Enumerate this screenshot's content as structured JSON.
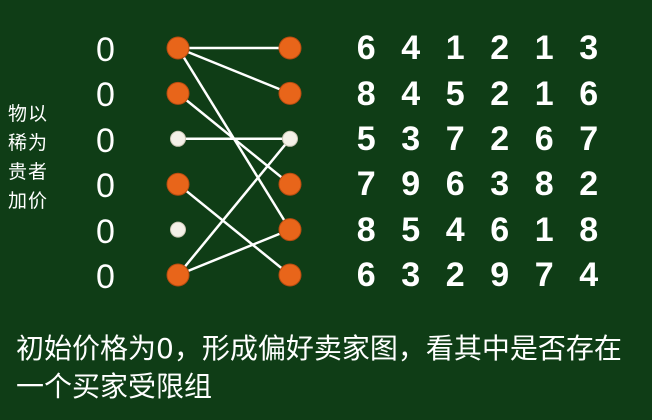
{
  "side_label": "物以稀为贵者加价",
  "prices": [
    "0",
    "0",
    "0",
    "0",
    "0",
    "0"
  ],
  "matrix": [
    [
      "6",
      "4",
      "1",
      "2",
      "1",
      "3"
    ],
    [
      "8",
      "4",
      "5",
      "2",
      "1",
      "6"
    ],
    [
      "5",
      "3",
      "7",
      "2",
      "6",
      "7"
    ],
    [
      "7",
      "9",
      "6",
      "3",
      "8",
      "2"
    ],
    [
      "8",
      "5",
      "4",
      "6",
      "1",
      "8"
    ],
    [
      "6",
      "3",
      "2",
      "9",
      "7",
      "4"
    ]
  ],
  "caption": "初始价格为0，形成偏好卖家图，看其中是否存在一个买家受限组",
  "graph": {
    "left_nodes": [
      "orange",
      "orange",
      "white",
      "orange",
      "white",
      "orange"
    ],
    "right_nodes": [
      "orange",
      "orange",
      "white",
      "orange",
      "orange",
      "orange"
    ],
    "edges": [
      [
        0,
        0
      ],
      [
        0,
        1
      ],
      [
        0,
        4
      ],
      [
        1,
        3
      ],
      [
        2,
        2
      ],
      [
        3,
        5
      ],
      [
        5,
        2
      ],
      [
        5,
        4
      ]
    ]
  },
  "colors": {
    "background": "#0f3d16",
    "node_orange": "#e8651a",
    "node_white": "#f4f1e8",
    "edge": "#ffffff"
  }
}
